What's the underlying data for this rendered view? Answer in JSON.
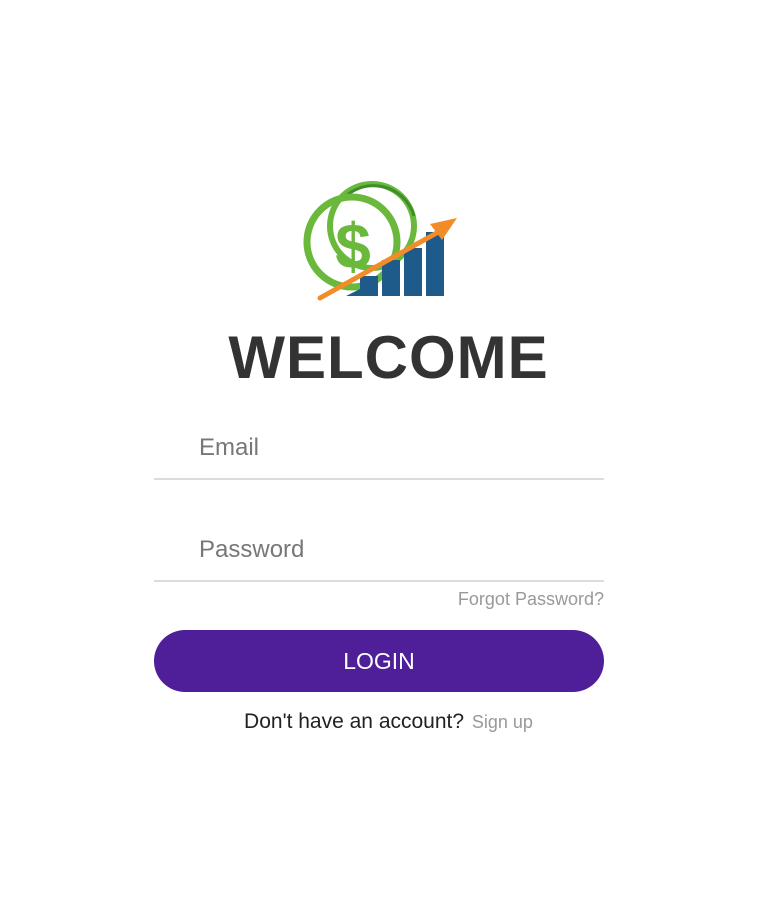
{
  "header": {
    "logo_icon": "money-growth-logo-icon",
    "title": "WELCOME"
  },
  "form": {
    "email_placeholder": "Email",
    "password_placeholder": "Password",
    "forgot_password": "Forgot Password?",
    "login_label": "LOGIN"
  },
  "footer": {
    "prompt": "Don't have an account?",
    "signup_link": "Sign up"
  },
  "colors": {
    "accent": "#4f1f9a",
    "logo_green": "#6ab93c",
    "logo_blue": "#1e5a8a",
    "logo_orange": "#f28c28",
    "title_text": "#333333",
    "muted_text": "#999999"
  }
}
